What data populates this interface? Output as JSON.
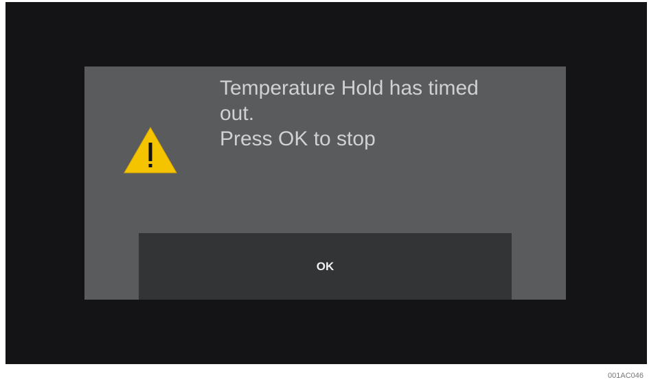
{
  "dialog": {
    "message_lines": [
      "Temperature Hold has timed",
      "out.",
      "Press OK to stop"
    ],
    "icon": "warning-icon",
    "ok_label": "OK"
  },
  "figure_code": "001AC046",
  "colors": {
    "screen_bg": "#141416",
    "dialog_bg": "#5a5b5d",
    "button_bg": "#323435",
    "text": "#cfd1d3",
    "warning_yellow": "#f5c400"
  }
}
